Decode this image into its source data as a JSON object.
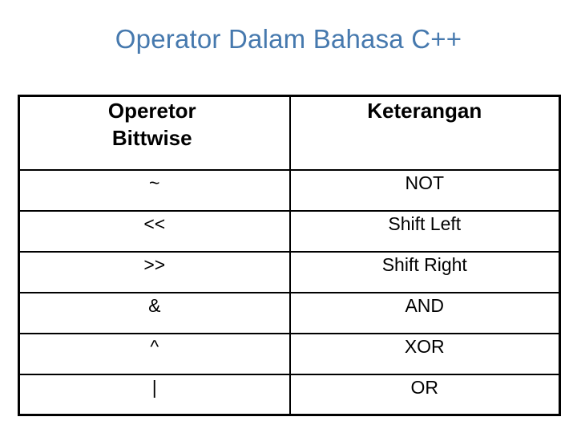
{
  "slide": {
    "title": "Operator Dalam Bahasa C++",
    "title_color": "#4679AE",
    "background_color": "#FFFFFF",
    "text_color": "#000000",
    "border_color": "#000000"
  },
  "table": {
    "headers": {
      "operator_line1": "Operetor",
      "operator_line2": "Bittwise",
      "keterangan": "Keterangan"
    },
    "rows": [
      {
        "operator": "~",
        "keterangan": "NOT"
      },
      {
        "operator": "<<",
        "keterangan": "Shift Left"
      },
      {
        "operator": ">>",
        "keterangan": "Shift Right"
      },
      {
        "operator": "&",
        "keterangan": "AND"
      },
      {
        "operator": "^",
        "keterangan": "XOR"
      },
      {
        "operator": "|",
        "keterangan": "OR"
      }
    ]
  }
}
